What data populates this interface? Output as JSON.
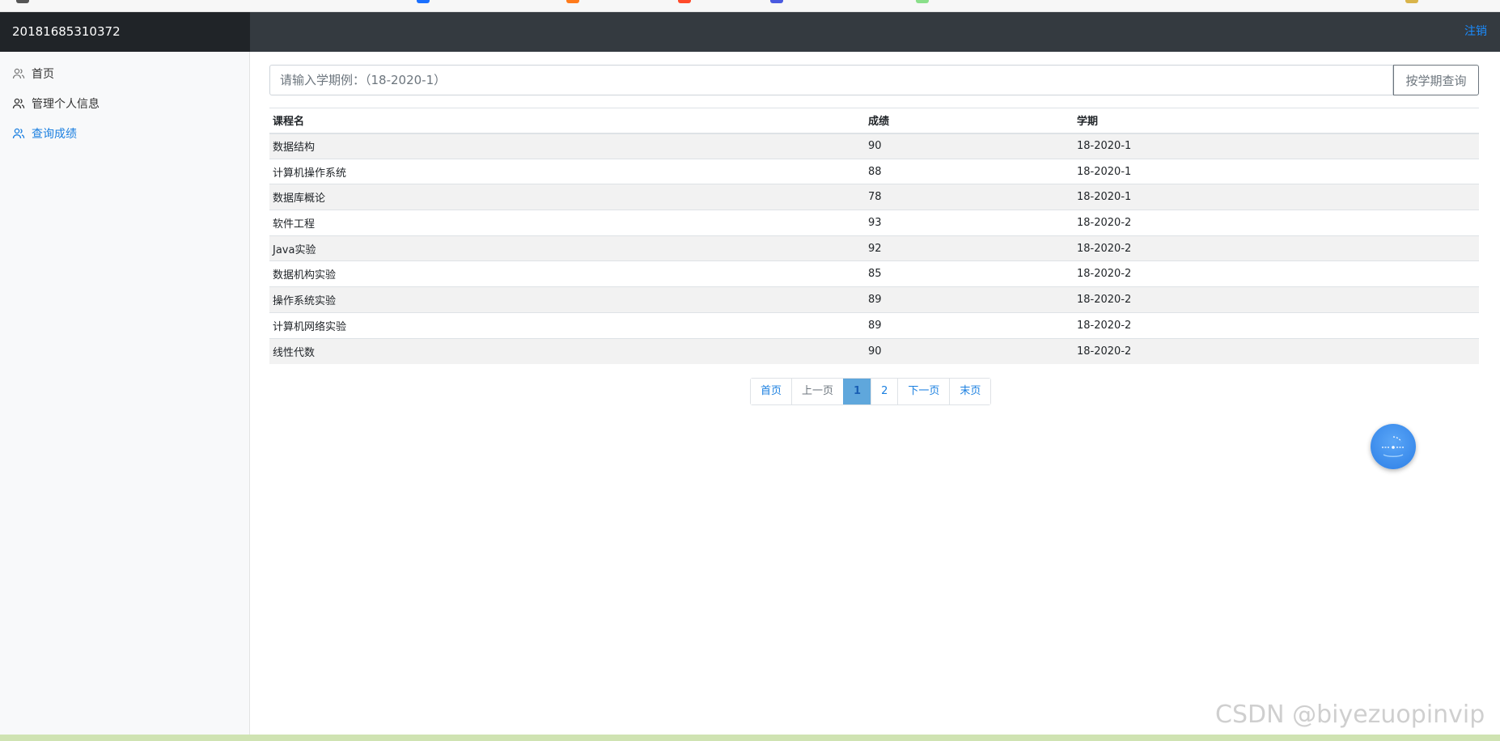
{
  "header": {
    "brand": "20181685310372",
    "logout_label": "注销"
  },
  "sidebar": {
    "items": [
      {
        "label": "首页",
        "icon": "users-icon",
        "active": false
      },
      {
        "label": "管理个人信息",
        "icon": "users-icon",
        "active": false
      },
      {
        "label": "查询成绩",
        "icon": "users-icon",
        "active": true
      }
    ]
  },
  "search": {
    "placeholder": "请输入学期例：（18-2020-1）",
    "button_label": "按学期查询"
  },
  "table": {
    "columns": [
      "课程名",
      "成绩",
      "学期"
    ],
    "rows": [
      [
        "数据结构",
        "90",
        "18-2020-1"
      ],
      [
        "计算机操作系统",
        "88",
        "18-2020-1"
      ],
      [
        "数据库概论",
        "78",
        "18-2020-1"
      ],
      [
        "软件工程",
        "93",
        "18-2020-2"
      ],
      [
        "Java实验",
        "92",
        "18-2020-2"
      ],
      [
        "数据机构实验",
        "85",
        "18-2020-2"
      ],
      [
        "操作系统实验",
        "89",
        "18-2020-2"
      ],
      [
        "计算机网络实验",
        "89",
        "18-2020-2"
      ],
      [
        "线性代数",
        "90",
        "18-2020-2"
      ]
    ]
  },
  "pagination": {
    "first": "首页",
    "prev": "上一页",
    "pages": [
      "1",
      "2"
    ],
    "current": "1",
    "next": "下一页",
    "last": "末页"
  },
  "watermark": "CSDN @biyezuopinvip",
  "colors": {
    "header_dark": "#343a40",
    "brand_dark": "#202428",
    "accent": "#1a7fe0",
    "active_page": "#5fa7dc"
  }
}
